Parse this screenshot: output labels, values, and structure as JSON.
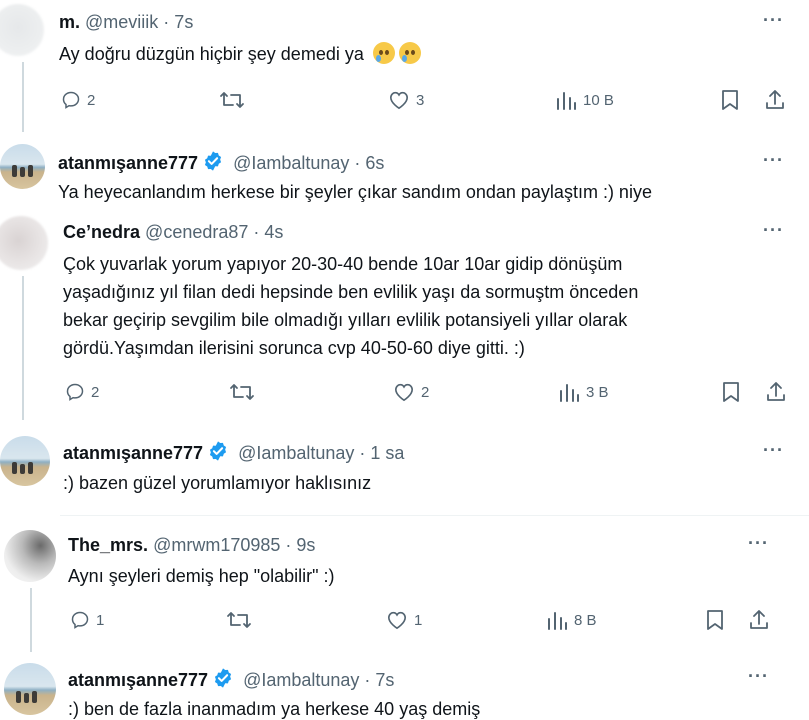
{
  "tweets": [
    {
      "name": "m.",
      "handle": "@meviiik · 7s",
      "text": "Ay doğru düzgün hiçbir şey demedi ya",
      "emojis": [
        "crying-face-emoji",
        "crying-face-emoji"
      ],
      "replies": "2",
      "likes": "3",
      "views": "10 B"
    },
    {
      "name": "atanmışanne777",
      "handle": "@Iambaltunay · 6s",
      "text": "Ya heyecanlandım herkese bir şeyler çıkar sandım ondan paylaştım :) niye"
    },
    {
      "name": "Ce’nedra",
      "handle": "@cenedra87 · 4s",
      "text_lines": [
        "Çok yuvarlak yorum yapıyor 20-30-40 bende 10ar 10ar gidip dönüşüm",
        "yaşadığınız yıl filan dedi hepsinde ben evlilik yaşı da sormuştm önceden",
        "bekar geçirip sevgilim bile olmadığı yılları evlilik potansiyeli yıllar olarak",
        "gördü.Yaşımdan ilerisini sorunca cvp 40-50-60 diye gitti. :)"
      ],
      "replies": "2",
      "likes": "2",
      "views": "3 B"
    },
    {
      "name": "atanmışanne777",
      "handle": "@Iambaltunay · 1 sa",
      "text": ":) bazen güzel yorumlamıyor haklısınız"
    },
    {
      "name": "The_mrs.",
      "handle": "@mrwm170985 · 9s",
      "text": "Aynı şeyleri demiş hep \"olabilir\" :)",
      "replies": "1",
      "likes": "1",
      "views": "8 B"
    },
    {
      "name": "atanmışanne777",
      "handle": "@Iambaltunay · 7s",
      "text": ":) ben de fazla inanmadım ya herkese 40 yaş demiş"
    }
  ],
  "more_label": "···",
  "colors": {
    "text": "#0f1419",
    "muted": "#536471",
    "verified": "#1d9bf0",
    "thread_line": "#cfd9de"
  }
}
